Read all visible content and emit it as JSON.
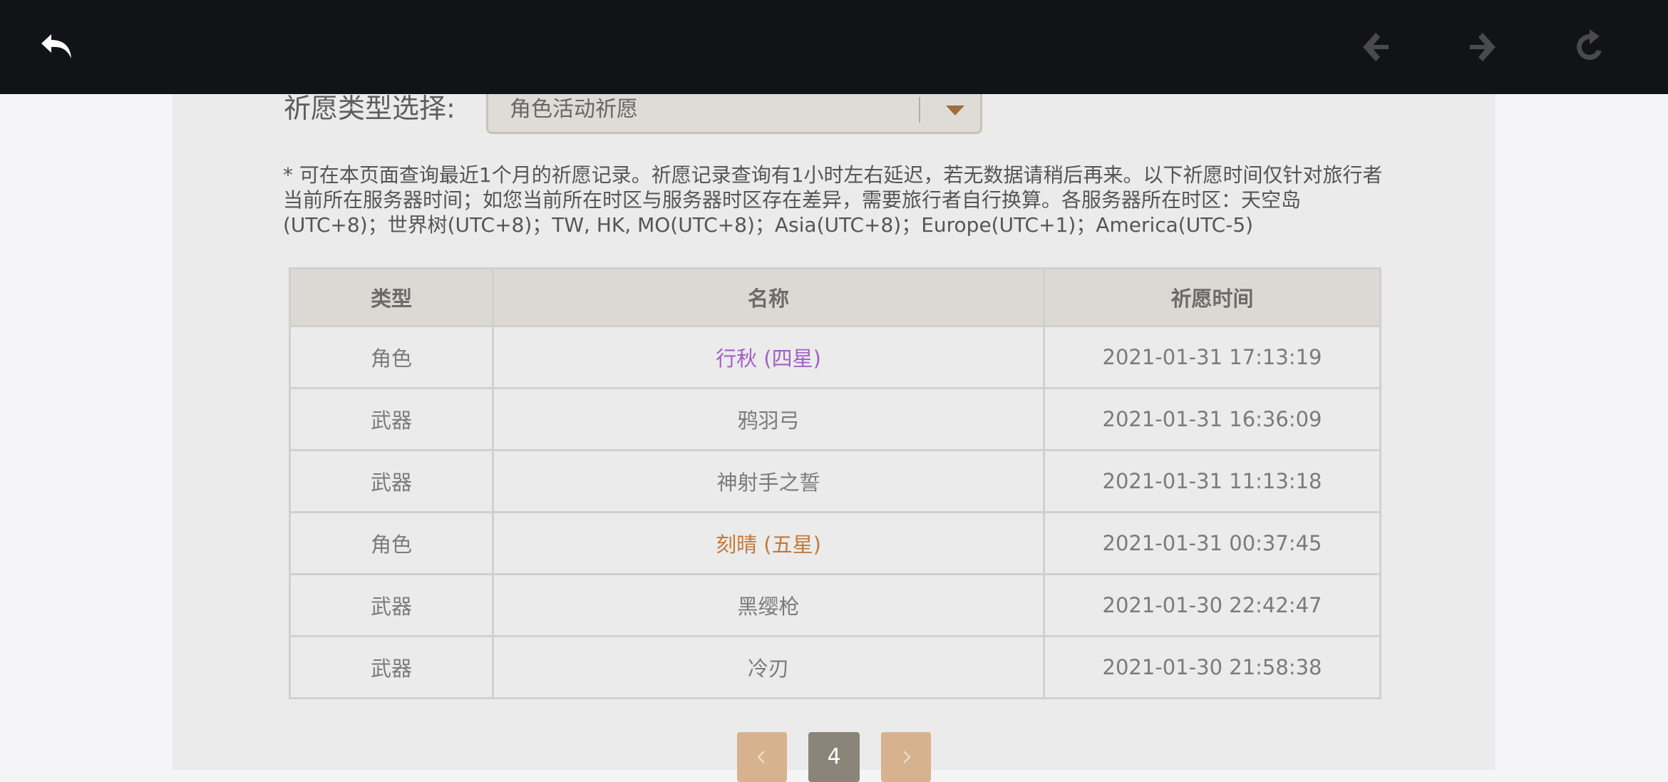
{
  "wish_type": {
    "label": "祈愿类型选择:",
    "selected": "角色活动祈愿"
  },
  "notice": "* 可在本页面查询最近1个月的祈愿记录。祈愿记录查询有1小时左右延迟，若无数据请稍后再来。以下祈愿时间仅针对旅行者当前所在服务器时间；如您当前所在时区与服务器时区存在差异，需要旅行者自行换算。各服务器所在时区：天空岛(UTC+8)；世界树(UTC+8)；TW, HK, MO(UTC+8)；Asia(UTC+8)；Europe(UTC+1)；America(UTC-5)",
  "table": {
    "headers": [
      "类型",
      "名称",
      "祈愿时间"
    ],
    "rows": [
      {
        "type": "角色",
        "name": "行秋 (四星)",
        "time": "2021-01-31 17:13:19",
        "rarity_color": "#a260c9"
      },
      {
        "type": "武器",
        "name": "鸦羽弓",
        "time": "2021-01-31 16:36:09"
      },
      {
        "type": "武器",
        "name": "神射手之誓",
        "time": "2021-01-31 11:13:18"
      },
      {
        "type": "角色",
        "name": "刻晴 (五星)",
        "time": "2021-01-31 00:37:45",
        "rarity_color": "#c27a3c"
      },
      {
        "type": "武器",
        "name": "黑缨枪",
        "time": "2021-01-30 22:42:47"
      },
      {
        "type": "武器",
        "name": "冷刃",
        "time": "2021-01-30 21:58:38"
      }
    ]
  },
  "pager": {
    "current": "4"
  },
  "icons": [
    "back-icon",
    "nav-back-icon",
    "nav-forward-icon",
    "refresh-icon",
    "chevron-down-icon",
    "chevron-left-icon",
    "chevron-right-icon"
  ]
}
